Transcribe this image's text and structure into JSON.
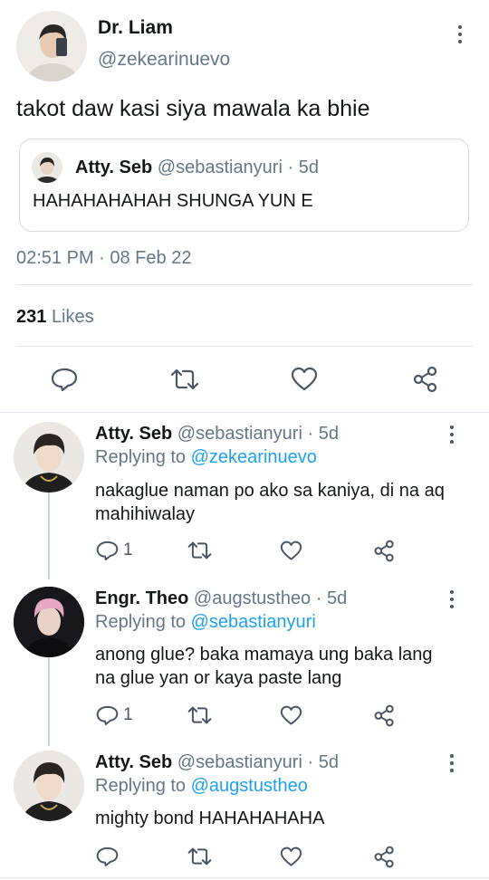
{
  "main_tweet": {
    "display_name": "Dr. Liam",
    "handle": "@zekearinuevo",
    "text": "takot daw kasi siya mawala ka bhie",
    "quoted": {
      "display_name": "Atty. Seb",
      "handle": "@sebastianyuri",
      "age": "· 5d",
      "text": "HAHAHAHAHAH SHUNGA YUN E"
    },
    "timestamp": "02:51 PM · 08 Feb 22",
    "likes_count": "231",
    "likes_label": "Likes"
  },
  "replies": [
    {
      "display_name": "Atty. Seb",
      "handle": "@sebastianyuri",
      "age": "· 5d",
      "replying_prefix": "Replying to",
      "replying_to": "@zekearinuevo",
      "text": "nakaglue naman po ako sa kaniya, di na aq mahihiwalay",
      "reply_count": "1"
    },
    {
      "display_name": "Engr. Theo",
      "handle": "@augstustheo",
      "age": "· 5d",
      "replying_prefix": "Replying to",
      "replying_to": "@sebastianyuri",
      "text": "anong glue? baka mamaya ung baka lang na glue yan or kaya paste lang",
      "reply_count": "1"
    },
    {
      "display_name": "Atty. Seb",
      "handle": "@sebastianyuri",
      "age": "· 5d",
      "replying_prefix": "Replying to",
      "replying_to": "@augstustheo",
      "text": "mighty bond HAHAHAHAHA",
      "reply_count": ""
    }
  ],
  "icons": {
    "reply": "reply-bubble-icon",
    "retweet": "retweet-icon",
    "like": "heart-icon",
    "share": "share-icon",
    "more": "kebab-menu-icon"
  },
  "colors": {
    "link": "#1da1f2",
    "secondary_text": "#657786",
    "icon": "#4b5563",
    "divider": "#e1e8ed"
  }
}
